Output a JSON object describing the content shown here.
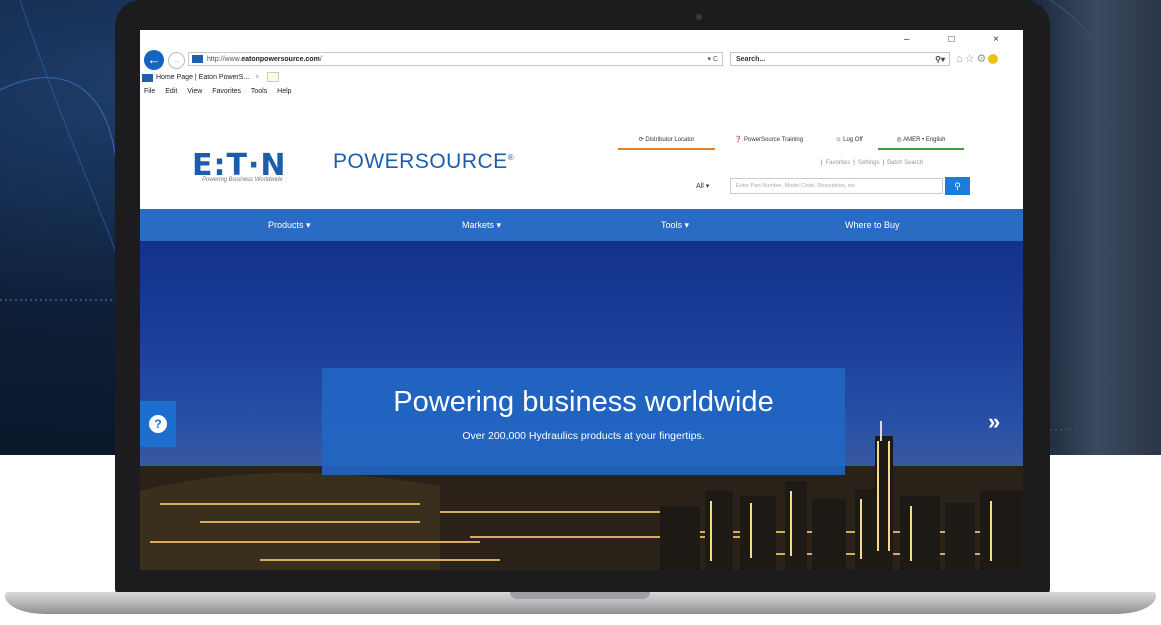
{
  "browser": {
    "address_prefix": "http://www.",
    "address_domain": "eatonpowersource.com",
    "address_suffix": "/",
    "address_controls": "▾ C",
    "search_placeholder": "Search...",
    "tab_title": "Home Page | Eaton PowerS...",
    "tab_close": "×",
    "menu": [
      "File",
      "Edit",
      "View",
      "Favorites",
      "Tools",
      "Help"
    ],
    "window_controls": "–  □  ×",
    "icons": [
      "home-icon",
      "star-icon",
      "gear-icon",
      "smiley-icon"
    ]
  },
  "site": {
    "logo": "E:T·N",
    "logo_tagline": "Powering Business Worldwide",
    "brand": "POWERSOURCE",
    "brand_mark": "®",
    "utility": {
      "distributor": "Distributor Locator",
      "training": "PowerSource Training",
      "logoff": "Log Off",
      "region": "AMER • English"
    },
    "util_links": [
      "Favorites",
      "Settings",
      "Batch Search"
    ],
    "search_scope": "All",
    "search_placeholder": "Enter Part Number, Model Code, Description, etc.",
    "nav": {
      "products": "Products ▾",
      "markets": "Markets ▾",
      "tools": "Tools ▾",
      "where": "Where to Buy"
    },
    "hero": {
      "title": "Powering business worldwide",
      "subtitle": "Over 200,000 Hydraulics products at your fingertips.",
      "next": "»",
      "help": "?"
    }
  },
  "colors": {
    "brand_blue": "#1b5eab",
    "nav_blue": "#2a6bc4",
    "accent_orange": "#e67e22",
    "accent_green": "#38a33a"
  }
}
